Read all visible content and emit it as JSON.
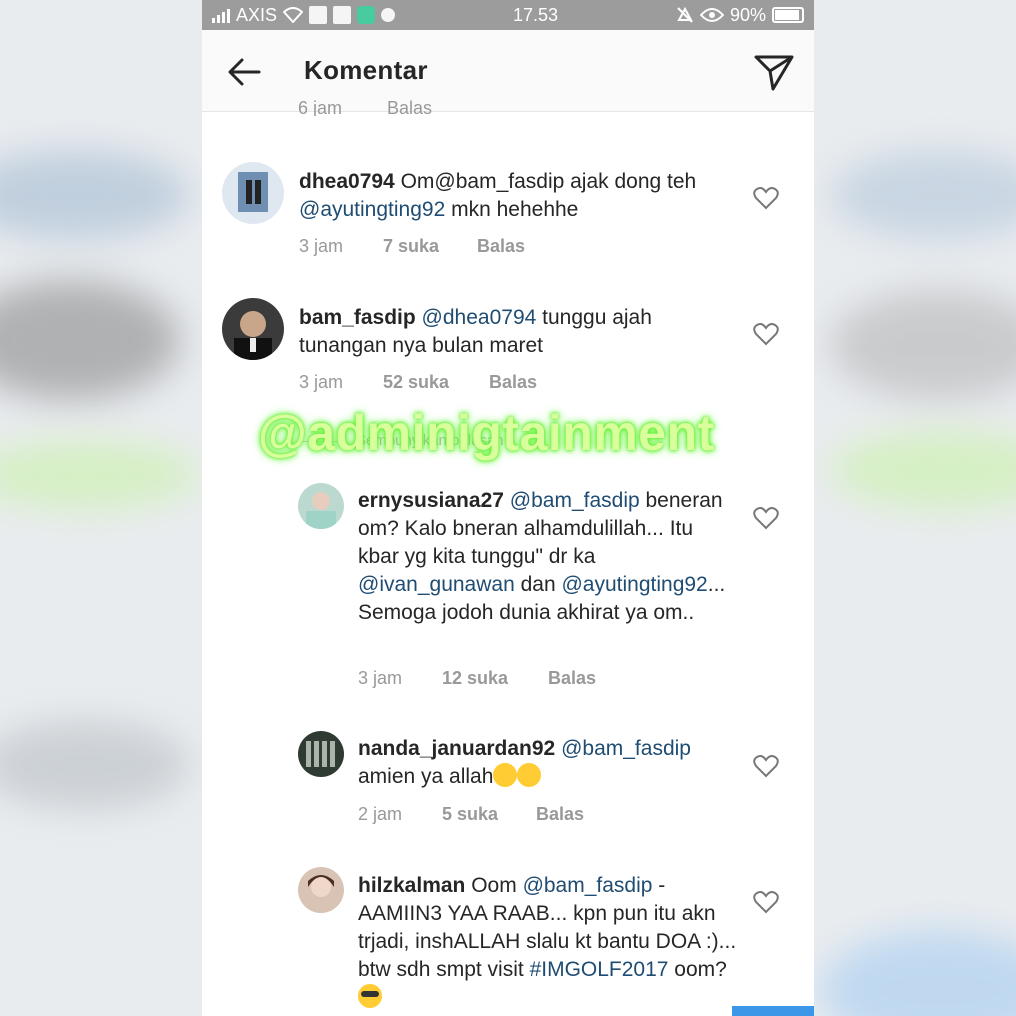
{
  "status_bar": {
    "carrier": "AXIS",
    "time": "17.53",
    "battery": "90%"
  },
  "header": {
    "title": "Komentar"
  },
  "partial_previous": {
    "time": "6 jam",
    "reply": "Balas"
  },
  "watermark": "@adminigtainment",
  "hide_replies": "Sembunyikan balasan",
  "comments": [
    {
      "username": "dhea0794",
      "segments": [
        {
          "text": " Om",
          "mention": false
        },
        {
          "text": "@bam_fasdip",
          "mention": false
        },
        {
          "text": " ajak dong teh ",
          "mention": false
        },
        {
          "text": "@ayutingting92",
          "mention": true
        },
        {
          "text": " mkn hehehhe",
          "mention": false
        }
      ],
      "time": "3 jam",
      "likes": "7 suka",
      "reply": "Balas"
    },
    {
      "username": "bam_fasdip",
      "segments": [
        {
          "text": " ",
          "mention": false
        },
        {
          "text": "@dhea0794",
          "mention": true
        },
        {
          "text": " tunggu ajah tunangan nya bulan maret",
          "mention": false
        }
      ],
      "time": "3 jam",
      "likes": "52 suka",
      "reply": "Balas"
    },
    {
      "username": "ernysusiana27",
      "segments": [
        {
          "text": " ",
          "mention": false
        },
        {
          "text": "@bam_fasdip",
          "mention": true
        },
        {
          "text": " beneran om? Kalo bneran alhamdulillah... Itu kbar yg kita tunggu\" dr ka ",
          "mention": false
        },
        {
          "text": "@ivan_gunawan",
          "mention": true
        },
        {
          "text": " dan ",
          "mention": false
        },
        {
          "text": "@ayutingting92",
          "mention": true
        },
        {
          "text": "... Semoga jodoh dunia akhirat ya om..",
          "mention": false
        }
      ],
      "time": "3 jam",
      "likes": "12 suka",
      "reply": "Balas"
    },
    {
      "username": "nanda_januardan92",
      "segments": [
        {
          "text": " ",
          "mention": false
        },
        {
          "text": "@bam_fasdip",
          "mention": true
        },
        {
          "text": " amien ya allah",
          "mention": false
        }
      ],
      "emoji": [
        "smile",
        "smile"
      ],
      "time": "2 jam",
      "likes": "5 suka",
      "reply": "Balas"
    },
    {
      "username": "hilzkalman",
      "segments": [
        {
          "text": " Oom ",
          "mention": false
        },
        {
          "text": "@bam_fasdip",
          "mention": true
        },
        {
          "text": " - AAMIIN3 YAA RAAB... kpn pun itu akn trjadi, inshALLAH slalu kt bantu DOA :)... btw sdh smpt visit ",
          "mention": false
        },
        {
          "text": "#IMGOLF2017",
          "mention": true
        },
        {
          "text": " oom? ",
          "mention": false
        }
      ],
      "emoji": [
        "cool"
      ]
    }
  ],
  "colors": {
    "mention": "#1f4c72",
    "status_bar": "#9c9c9c",
    "watermark_glow": "#5ef12a"
  }
}
